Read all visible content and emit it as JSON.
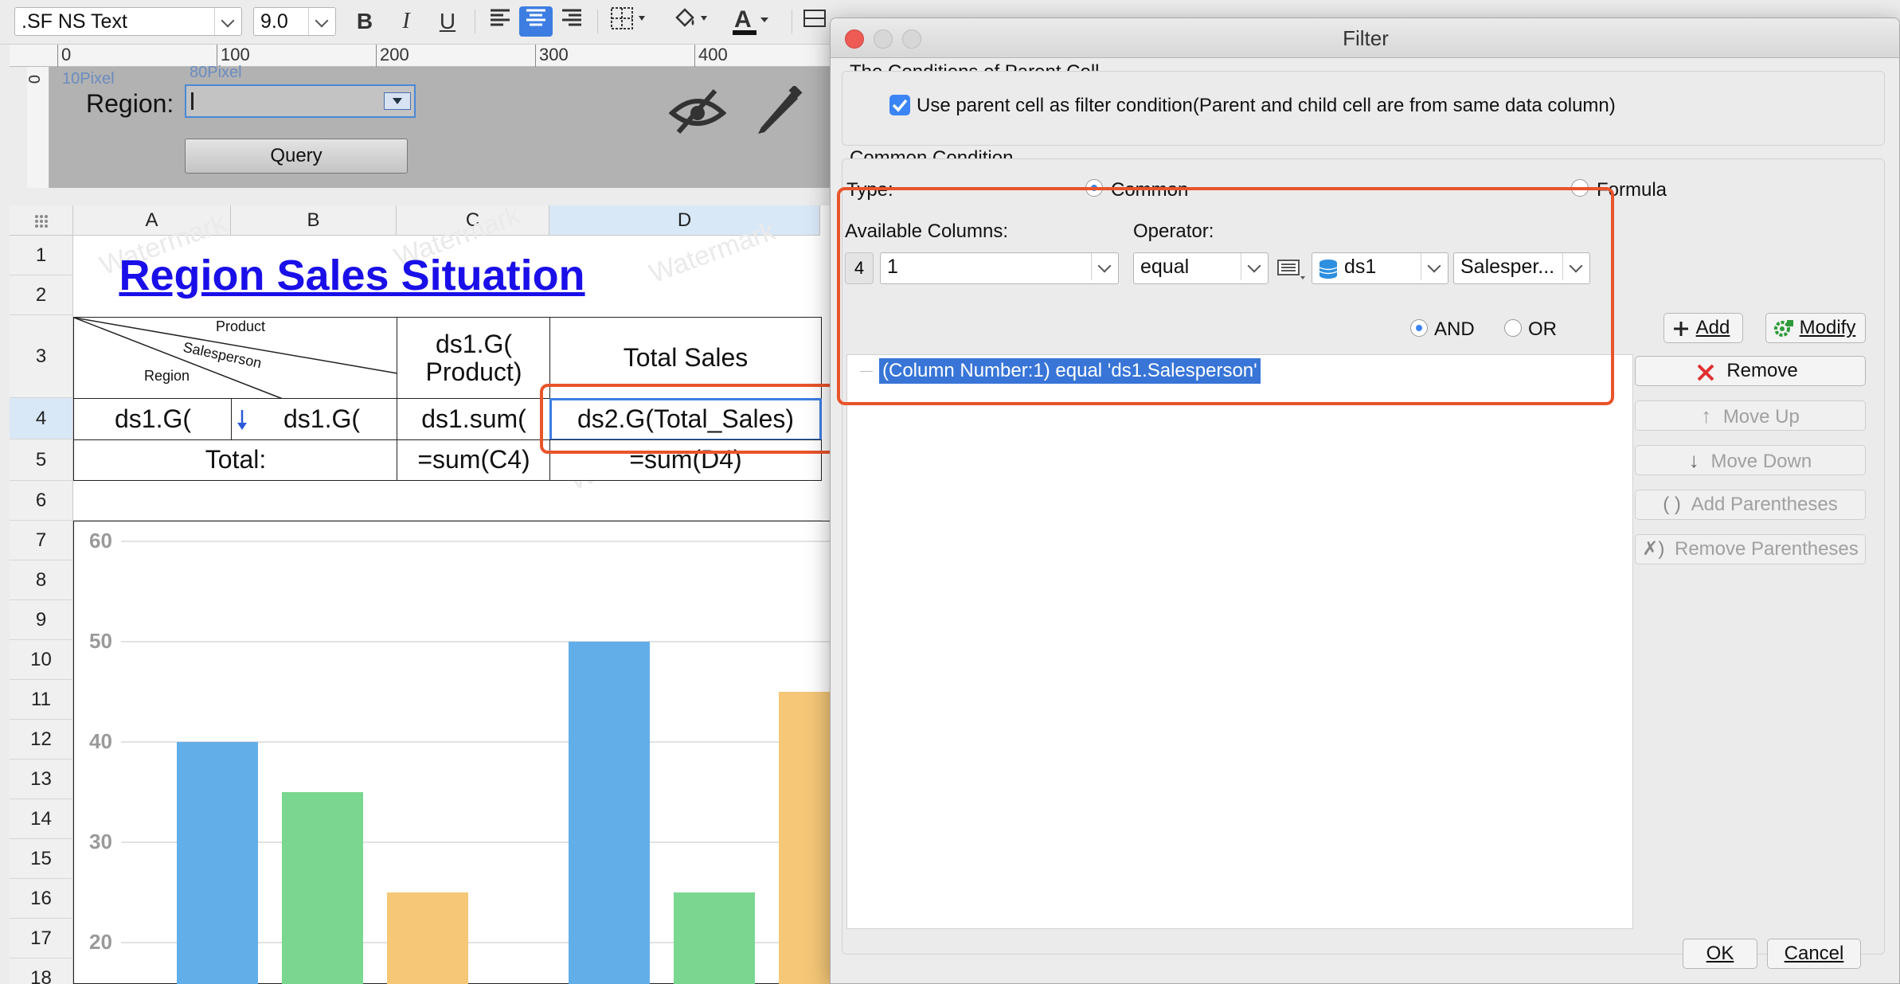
{
  "toolbar": {
    "font_name": ".SF NS Text",
    "font_size": "9.0",
    "bold": "B",
    "italic": "I",
    "underline": "U",
    "font_color": "A"
  },
  "ruler": {
    "ticks": [
      "0",
      "100",
      "200",
      "300",
      "400"
    ],
    "vertical_zero": "0"
  },
  "param_pane": {
    "region_label": "Region:",
    "width_hint": "80Pixel",
    "height_hint": "10Pixel",
    "query_button": "Query"
  },
  "grid": {
    "columns": [
      "A",
      "B",
      "C",
      "D"
    ],
    "rows": [
      "1",
      "2",
      "3",
      "4",
      "5",
      "6",
      "7",
      "8",
      "9",
      "10",
      "11",
      "12",
      "13",
      "14",
      "15",
      "16",
      "17",
      "18"
    ],
    "title": "Region Sales Situation",
    "header_slash": {
      "product": "Product",
      "salesperson": "Salesperson",
      "region": "Region"
    },
    "c3": "ds1.G(\nProduct)",
    "d3": "Total Sales",
    "a4": "ds1.G(",
    "b4": "ds1.G(",
    "c4": "ds1.sum(",
    "d4": "ds2.G(Total_Sales)",
    "a5": "Total:",
    "c5": "=sum(C4)",
    "d5": "=sum(D4)",
    "watermark": "Watermark"
  },
  "chart_data": {
    "type": "bar",
    "title": "",
    "xlabel": "",
    "ylabel": "",
    "yticks": [
      20,
      30,
      40,
      50,
      60
    ],
    "ylim": [
      20,
      60
    ],
    "colors": [
      "#62aee9",
      "#79d78f",
      "#f5c777"
    ],
    "groups": [
      {
        "values": [
          40,
          35,
          25
        ]
      },
      {
        "values": [
          50,
          25,
          45
        ]
      }
    ]
  },
  "dialog": {
    "title": "Filter",
    "parent_section": "The Conditions of Parent Cell",
    "use_parent_label": "Use parent cell as filter condition(Parent and child cell are from same data column)",
    "use_parent_checked": true,
    "common_section": "Common Condition",
    "type_label": "Type:",
    "type_common": "Common",
    "type_formula": "Formula",
    "available_columns_label": "Available Columns:",
    "column_index_badge": "4",
    "column_value": "1",
    "operator_label": "Operator:",
    "operator_value": "equal",
    "dataset_value": "ds1",
    "field_value": "Salesper...",
    "and_label": "AND",
    "or_label": "OR",
    "condition_item": "(Column Number:1) equal 'ds1.Salesperson'",
    "add_button": "Add",
    "modify_button": "Modify",
    "remove_button": "Remove",
    "move_up_button": "Move Up",
    "move_down_button": "Move Down",
    "add_parentheses_button": "Add Parentheses",
    "remove_parentheses_button": "Remove Parentheses",
    "ok_button": "OK",
    "cancel_button": "Cancel"
  },
  "colors": {
    "highlight_box": "#e9542a",
    "selection": "#3d7de2",
    "link_title": "#1a0fe8"
  }
}
